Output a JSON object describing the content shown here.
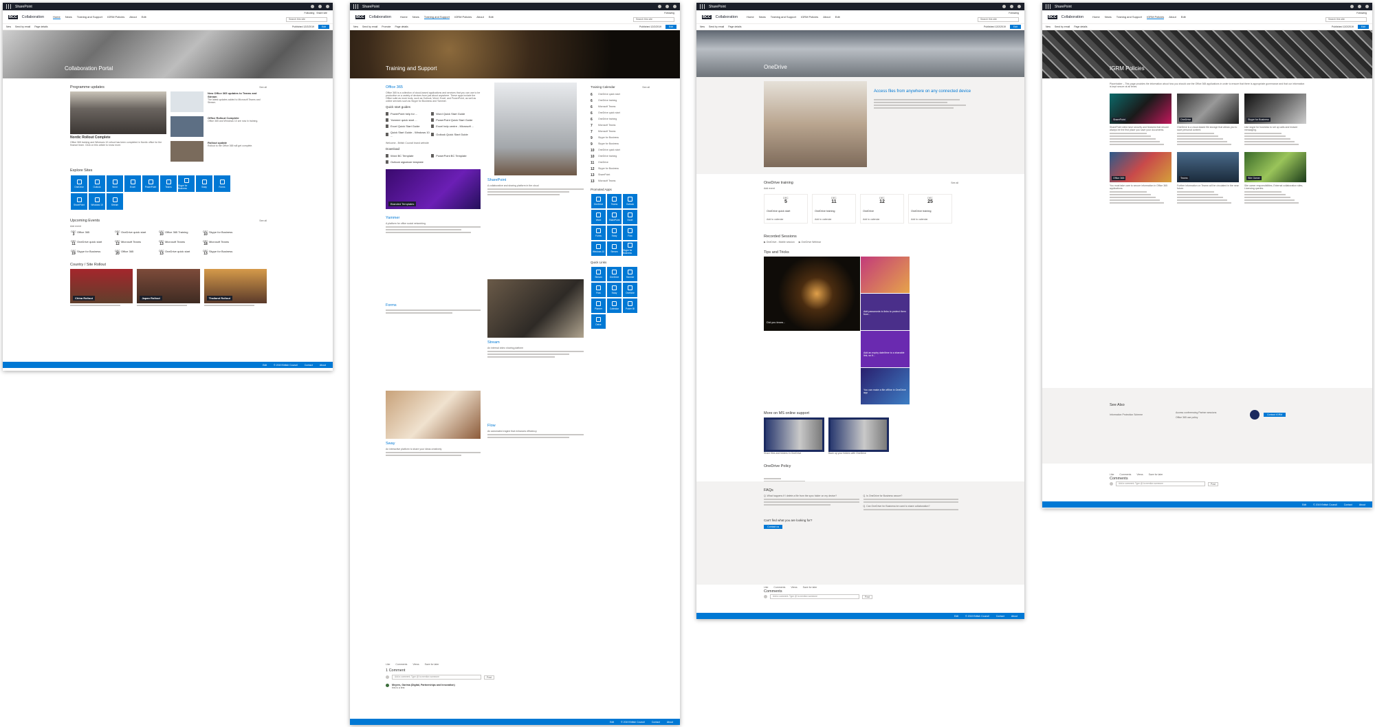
{
  "common": {
    "suite_title": "SharePoint",
    "site_title": "Collaboration",
    "logo_text": "BCC",
    "nav": [
      "Home",
      "News",
      "Training and Support",
      "IGRM Policies",
      "About",
      "Edit"
    ],
    "following": "Following",
    "share_site": "Share site",
    "search_placeholder": "Search this site",
    "cmd": {
      "new": "New",
      "send": "Send by email",
      "promote": "Promote",
      "details": "Page details",
      "published": "Published 12/2/2019",
      "edit": "Edit"
    },
    "footer": {
      "edit": "Edit",
      "copyright": "© 2019 British Council",
      "contact": "Contact",
      "about": "About"
    },
    "colors": {
      "accent": "#0078d4",
      "suitebar": "#1b1f2a",
      "grey": "#f3f2f1"
    }
  },
  "home": {
    "hero_title": "Collaboration Portal",
    "programme_updates": "Programme updates",
    "see_all": "See all",
    "main_news": {
      "title": "Nordic Rollout Complete",
      "body": "Office 365 training and Windows 10 rollout has been completed in Nordic office for the finance team. Click on this article to know more."
    },
    "news": [
      {
        "title": "New Office 365 updates to Teams and Stream",
        "body": "The latest updates added to Microsoft Teams and Stream."
      },
      {
        "title": "Office Rollout Complete",
        "body": "Office 365 and Windows 10 are now in training."
      },
      {
        "title": "Rollout update",
        "body": "Rollout to the Office 365 will get complete."
      }
    ],
    "explore_title": "Explore Sites",
    "tiles": [
      "OneDrive",
      "Outlook",
      "Word",
      "Excel",
      "PowerPoint",
      "Teams",
      "Skype for Business",
      "Sway",
      "Forms",
      "SharePoint",
      "Windows 10",
      "Stream"
    ],
    "events_title": "Upcoming Events",
    "add_event": "Add event",
    "events": [
      {
        "m": "DEC",
        "d": "3",
        "t": "Office 365"
      },
      {
        "m": "DEC",
        "d": "4",
        "t": "OneDrive quick start"
      },
      {
        "m": "DEC",
        "d": "10",
        "t": "Office 365 Training"
      },
      {
        "m": "DEC",
        "d": "10",
        "t": "Skype for Business"
      },
      {
        "m": "DEC",
        "d": "11",
        "t": "OneDrive quick start"
      },
      {
        "m": "DEC",
        "d": "12",
        "t": "Microsoft Teams"
      },
      {
        "m": "DEC",
        "d": "13",
        "t": "Microsoft Teams"
      },
      {
        "m": "DEC",
        "d": "18",
        "t": "Microsoft Teams"
      },
      {
        "m": "DEC",
        "d": "19",
        "t": "Skype for Business"
      },
      {
        "m": "DEC",
        "d": "20",
        "t": "Office 365"
      },
      {
        "m": "DEC",
        "d": "13",
        "t": "OneDrive quick start"
      },
      {
        "m": "DEC",
        "d": "13",
        "t": "Skype for Business"
      }
    ],
    "rollout_title": "Country / Site Rollout",
    "rollouts": [
      "China Rollout",
      "Japan Rollout",
      "Thailand Rollout"
    ]
  },
  "training": {
    "hero_title": "Training and Support",
    "o365": "Office 365",
    "o365_body": "Office 365 is a collection of cloud-based applications and services that you can use to be productive on a variety of devices from just about anywhere. These apps include the Office suite as more tools, such as Outlook, Word, Excel, and PowerPoint, as well as online services such as Skype for Business and Yammer.",
    "quick_start": "Quick start guides",
    "docs": [
      "PowerPoint help for ...",
      "Word Quick Start Guide",
      "Yammer quick start ...",
      "PowerPoint Quick Start Guide",
      "Excel Quick Start Guide",
      "Excel help centre - Microsoft ...",
      "Quick Start Guide - Windows 10 ...",
      "Outlook Quick Start Guide"
    ],
    "welcome": "Welcome - British Council brand website",
    "download": "Download",
    "downloads": [
      "Word BC Template",
      "PowerPoint BC Template",
      "Outlook signature template"
    ],
    "branded": "Branded Templates",
    "sharepoint": "SharePoint",
    "sharepoint_sub": "A collaborative and sharing platform in the cloud",
    "yammer": "Yammer",
    "yammer_sub": "A platform for office social networking",
    "forms": "Forms",
    "stream": "Stream",
    "stream_sub": "An internal video sharing platform",
    "flow": "Flow",
    "flow_sub": "An automated engine that enhances efficiency",
    "sway": "Sway",
    "sway_sub": "An interactive platform to share your ideas creatively",
    "calendar": "Training Calendar",
    "cal": [
      {
        "d": "6",
        "t": "OneDrive quick start"
      },
      {
        "d": "6",
        "t": "OneDrive training"
      },
      {
        "d": "6",
        "t": "Microsoft Teams"
      },
      {
        "d": "6",
        "t": "OneDrive quick start"
      },
      {
        "d": "6",
        "t": "OneDrive training"
      },
      {
        "d": "7",
        "t": "Microsoft Teams"
      },
      {
        "d": "7",
        "t": "Microsoft Teams"
      },
      {
        "d": "9",
        "t": "Skype for Business"
      },
      {
        "d": "9",
        "t": "Skype for Business"
      },
      {
        "d": "10",
        "t": "OneDrive quick start"
      },
      {
        "d": "10",
        "t": "OneDrive training"
      },
      {
        "d": "11",
        "t": "OneDrive"
      },
      {
        "d": "12",
        "t": "Skype for Business"
      },
      {
        "d": "13",
        "t": "SharePoint"
      },
      {
        "d": "13",
        "t": "Microsoft Teams"
      }
    ],
    "promoted": "Promoted Apps",
    "tiles": [
      "OneDrive",
      "Teams",
      "Outlook",
      "Word",
      "SharePoint",
      "Excel",
      "Forms",
      "Sway",
      "Flow",
      "Windows 10",
      "Stream",
      "Skype for Business"
    ],
    "quick_links": "Quick Links",
    "qlinks": [
      "Stream",
      "OneDrive",
      "Yammer",
      "Flow",
      "Sway",
      "OneNote",
      "Planner",
      "Calendar",
      "Power BI",
      "Delve"
    ],
    "comments_title": "1 Comment",
    "add_comment": "Add a comment. Type @ to mention someone",
    "post": "Post",
    "comment_author": "Meyers, Garima (Digital, Partnerships and Innovation)",
    "comment_text": "this is a test",
    "like": "Like",
    "comments": "Comments",
    "views": "Views",
    "save": "Save for later"
  },
  "onedrive": {
    "hero_title": "OneDrive",
    "access": "Access files from anywhere on any connected device",
    "training": "OneDrive training",
    "add_event": "Add event",
    "events": [
      {
        "m": "DEC",
        "d": "5",
        "t": "OneDrive quick start"
      },
      {
        "m": "DEC",
        "d": "11",
        "t": "OneDrive training"
      },
      {
        "m": "DEC",
        "d": "12",
        "t": "OneDrive"
      },
      {
        "m": "DEC",
        "d": "25",
        "t": "OneDrive training"
      }
    ],
    "add_calendar": "Add to calendar",
    "sessions": "Recorded Sessions",
    "sess": [
      "OneDrive - Mobile session",
      "OneDrive Webinar"
    ],
    "tips": "Tips and Tricks",
    "tip_cards": [
      "Did you know...",
      "Add passwords to links to protect them from...",
      "Add an expiry date/time to a sharable link, so it...",
      "You can make a file offline in OneDrive app"
    ],
    "more_support": "More on MS online support",
    "support_items": [
      "Share files and folders in OneDrive",
      "Back up your folders with OneDrive"
    ],
    "policy": "OneDrive Policy",
    "faq": "FAQs",
    "faq_q1": "Q. What happens if I delete a file from the sync folder on my device?",
    "faq_q2": "Q. Is OneDrive for Business secure?",
    "faq_q3": "Q. Can OneDrive for Business be used to share collaboration?",
    "cant_find": "Can't find what you are looking for?",
    "contact": "Contact us",
    "comments_title": "Comments"
  },
  "igrm": {
    "hero_title": "IGRM Policies",
    "intro": "Placeholder – This page provides the information about how you should use the Office 365 applications in order to ensure that there is appropriate governance and that our information is kept secure at all times.",
    "cards": [
      {
        "title": "SharePoint",
        "body": "SharePoint sites have security and features that should always be the first place you save your documents."
      },
      {
        "title": "OneDrive",
        "body": "OneDrive is a cloud-based file storage that allows you to save personal content."
      },
      {
        "title": "Skype for Business",
        "body": "Use skype for business to set up calls and Instant messaging."
      },
      {
        "title": "Office 365",
        "body": "You must take care to secure information in Office 365 applications."
      },
      {
        "title": "Teams",
        "body": "Further information on Teams will be circulated in the near future."
      },
      {
        "title": "Site Owner",
        "body": "Site owner responsibilities, External collaboration sites, Licensing queries."
      }
    ],
    "see_also": "See Also",
    "see_items": [
      "Information Protection Scheme",
      "Access conferencing Partner sessions",
      "Office 365 use policy"
    ],
    "contact": "Contact IGRM",
    "comments_title": "Comments"
  }
}
